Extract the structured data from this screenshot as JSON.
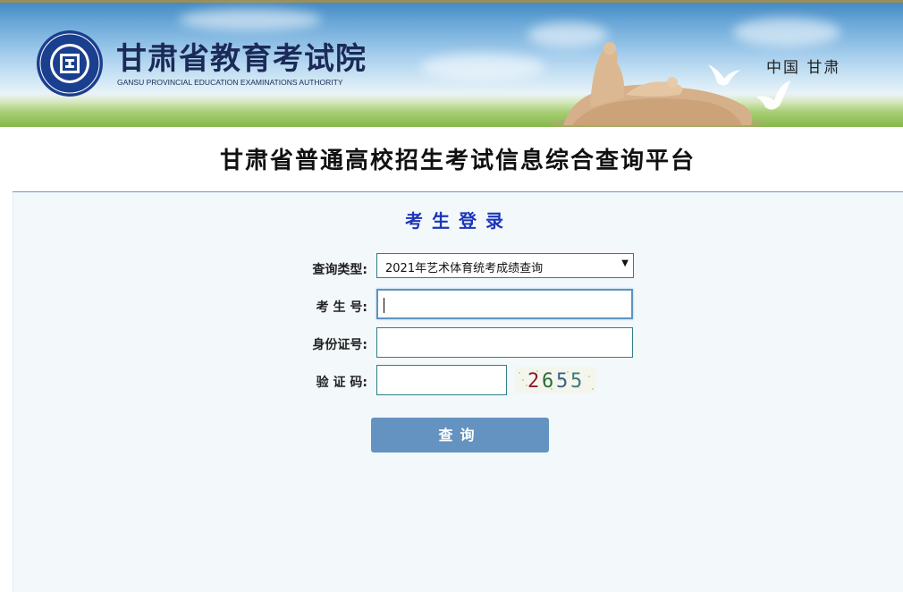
{
  "header": {
    "org_name_cn": "甘肃省教育考试院",
    "org_name_en": "GANSU PROVINCIAL EDUCATION EXAMINATIONS AUTHORITY",
    "region": "中国 甘肃",
    "logo_icon": "exam-authority-emblem-icon"
  },
  "platform": {
    "title": "甘肃省普通高校招生考试信息综合查询平台"
  },
  "login": {
    "title": "考生登录",
    "query_type_label": "查询类型:",
    "query_type_value": "2021年艺术体育统考成绩查询",
    "exam_no_label": "考 生 号:",
    "exam_no_value": "",
    "id_label": "身份证号:",
    "id_value": "",
    "captcha_label": "验 证 码:",
    "captcha_value": "",
    "captcha_text": "2655",
    "submit_label": "查询"
  },
  "colors": {
    "accent": "#1d35b8",
    "button": "#6493c1",
    "input_border": "#2f7f86",
    "content_bg": "#f3f8fb"
  }
}
